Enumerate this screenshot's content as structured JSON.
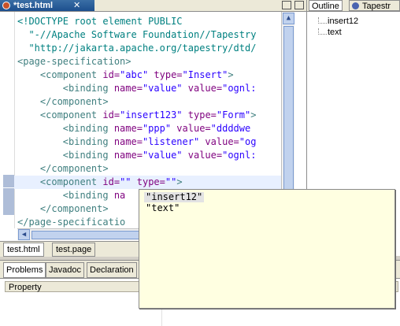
{
  "editor": {
    "tab_title": "*test.html",
    "tab_close": "✕",
    "lines": [
      {
        "parts": [
          {
            "t": "<!DOCTYPE root element PUBLIC",
            "c": "doc"
          }
        ]
      },
      {
        "parts": [
          {
            "t": "  \"-//Apache Software Foundation//Tapestry",
            "c": "doc"
          }
        ]
      },
      {
        "parts": [
          {
            "t": "  \"http://jakarta.apache.org/tapestry/dtd/",
            "c": "doc"
          }
        ]
      },
      {
        "parts": [
          {
            "t": "<page-specification>",
            "c": "tag"
          }
        ]
      },
      {
        "parts": [
          {
            "t": "    <component ",
            "c": "tag"
          },
          {
            "t": "id=",
            "c": "att"
          },
          {
            "t": "\"abc\"",
            "c": "val"
          },
          {
            "t": " type=",
            "c": "att"
          },
          {
            "t": "\"Insert\"",
            "c": "val"
          },
          {
            "t": ">",
            "c": "tag"
          }
        ]
      },
      {
        "parts": [
          {
            "t": "        <binding ",
            "c": "tag"
          },
          {
            "t": "name=",
            "c": "att"
          },
          {
            "t": "\"value\"",
            "c": "val"
          },
          {
            "t": " value=",
            "c": "att"
          },
          {
            "t": "\"ognl:",
            "c": "val"
          }
        ]
      },
      {
        "parts": [
          {
            "t": "    </component>",
            "c": "tag"
          }
        ]
      },
      {
        "parts": [
          {
            "t": "    <component ",
            "c": "tag"
          },
          {
            "t": "id=",
            "c": "att"
          },
          {
            "t": "\"insert123\"",
            "c": "val"
          },
          {
            "t": " type=",
            "c": "att"
          },
          {
            "t": "\"Form\"",
            "c": "val"
          },
          {
            "t": ">",
            "c": "tag"
          }
        ]
      },
      {
        "parts": [
          {
            "t": "        <binding ",
            "c": "tag"
          },
          {
            "t": "name=",
            "c": "att"
          },
          {
            "t": "\"ppp\"",
            "c": "val"
          },
          {
            "t": " value=",
            "c": "att"
          },
          {
            "t": "\"ddddwe",
            "c": "val"
          }
        ]
      },
      {
        "parts": [
          {
            "t": "        <binding ",
            "c": "tag"
          },
          {
            "t": "name=",
            "c": "att"
          },
          {
            "t": "\"listener\"",
            "c": "val"
          },
          {
            "t": " value=",
            "c": "att"
          },
          {
            "t": "\"og",
            "c": "val"
          }
        ]
      },
      {
        "parts": [
          {
            "t": "        <binding ",
            "c": "tag"
          },
          {
            "t": "name=",
            "c": "att"
          },
          {
            "t": "\"value\"",
            "c": "val"
          },
          {
            "t": " value=",
            "c": "att"
          },
          {
            "t": "\"ognl:",
            "c": "val"
          }
        ]
      },
      {
        "parts": [
          {
            "t": "    </component>",
            "c": "tag"
          }
        ]
      },
      {
        "parts": [
          {
            "t": "    <component ",
            "c": "tag"
          },
          {
            "t": "id=",
            "c": "att"
          },
          {
            "t": "\"\"",
            "c": "val"
          },
          {
            "t": " type=",
            "c": "att"
          },
          {
            "t": "\"\"",
            "c": "val"
          },
          {
            "t": ">",
            "c": "tag"
          }
        ]
      },
      {
        "parts": [
          {
            "t": "        <binding ",
            "c": "tag"
          },
          {
            "t": "na",
            "c": "att"
          }
        ]
      },
      {
        "parts": [
          {
            "t": "    </component>",
            "c": "tag"
          }
        ]
      },
      {
        "parts": [
          {
            "t": "</page-specificatio",
            "c": "tag"
          }
        ]
      }
    ],
    "bottom_tabs": [
      "test.html",
      "test.page"
    ]
  },
  "outline": {
    "tabs": [
      "Outline",
      "Tapestr"
    ],
    "items": [
      "insert12",
      "text"
    ]
  },
  "bottom_panel": {
    "tabs": [
      "Problems",
      "Javadoc",
      "Declaration"
    ],
    "column_header": "Property"
  },
  "content_assist": {
    "items": [
      "\"insert12\"",
      "\"text\""
    ],
    "selected_index": 0
  },
  "colors": {
    "tag": "#3f7f7f",
    "attribute": "#7f007f",
    "value": "#2a00ff",
    "popup_bg": "#ffffe1"
  }
}
